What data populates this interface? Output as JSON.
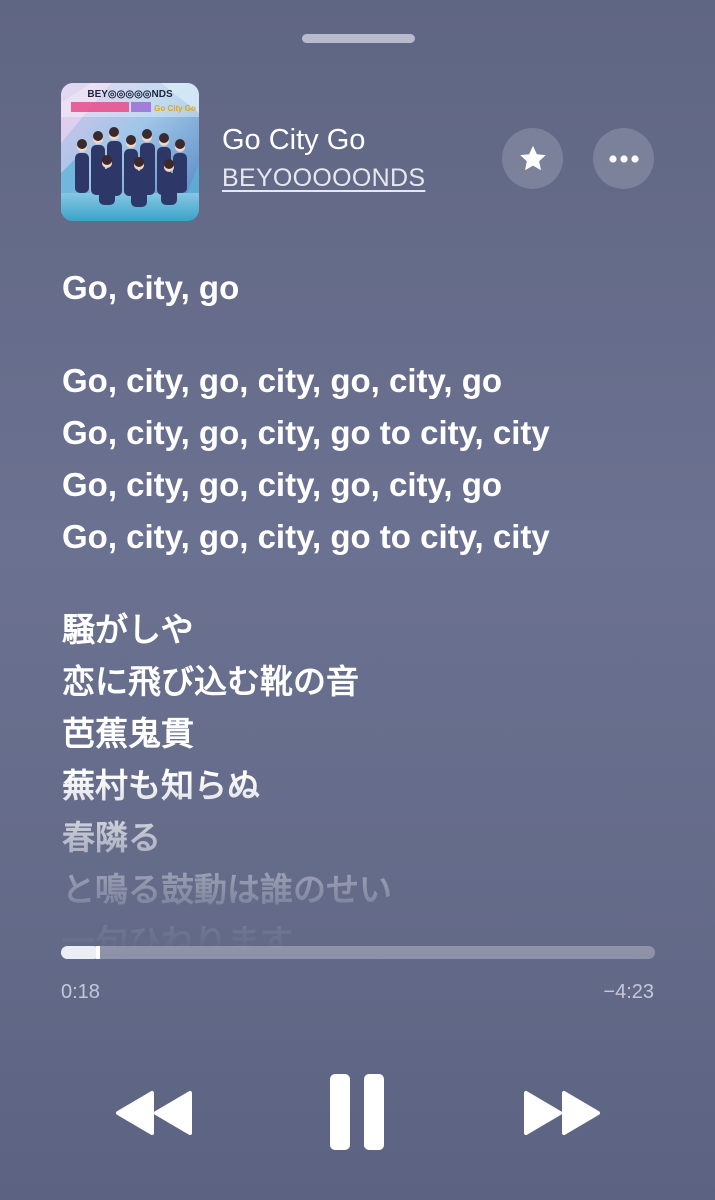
{
  "now_playing": {
    "title": "Go City Go",
    "artist": "BEYOOOOONDS"
  },
  "album_art": {
    "alt": "Go City Go album cover",
    "logo_text": "BEY◎◎◎◎◎NDS",
    "tag_text": "Go City Go"
  },
  "actions": {
    "favorite_icon": "star-icon",
    "more_icon": "ellipsis-icon"
  },
  "lyrics": {
    "lines": [
      "Go, city, go",
      "",
      "Go, city, go, city, go, city, go",
      "Go, city, go, city, go to city, city",
      "Go, city, go, city, go, city, go",
      "Go, city, go, city, go to city, city",
      "",
      "騒がしや",
      "恋に飛び込む靴の音",
      "芭蕉鬼貫",
      "蕪村も知らぬ",
      "春隣る",
      "と鳴る鼓動は誰のせい",
      "一句ひねります"
    ]
  },
  "playback": {
    "elapsed": "0:18",
    "remaining": "−4:23",
    "progress": 0.066,
    "state": "playing"
  },
  "controls": {
    "rewind_icon": "rewind-icon",
    "pause_icon": "pause-icon",
    "forward_icon": "fast-forward-icon"
  },
  "colors": {
    "background": "#646b89",
    "accent": "#ffffff"
  }
}
